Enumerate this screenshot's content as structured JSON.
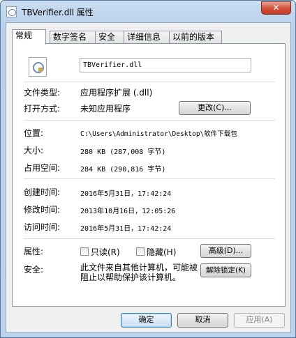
{
  "window": {
    "title": "TBVerifier.dll 属性",
    "close_label": "✕"
  },
  "tabs": [
    {
      "label": "常规"
    },
    {
      "label": "数字签名"
    },
    {
      "label": "安全"
    },
    {
      "label": "详细信息"
    },
    {
      "label": "以前的版本"
    }
  ],
  "general": {
    "filename": "TBVerifier.dll",
    "file_type_label": "文件类型:",
    "file_type_value": "应用程序扩展 (.dll)",
    "open_with_label": "打开方式:",
    "open_with_value": "未知应用程序",
    "change_button": "更改(C)...",
    "location_label": "位置:",
    "location_value": "C:\\Users\\Administrator\\Desktop\\软件下载包",
    "size_label": "大小:",
    "size_value": "280 KB (287,008 字节)",
    "size_on_disk_label": "占用空间:",
    "size_on_disk_value": "284 KB (290,816 字节)",
    "created_label": "创建时间:",
    "created_value": "2016年5月31日，17:42:24",
    "modified_label": "修改时间:",
    "modified_value": "2013年10月16日，12:05:26",
    "accessed_label": "访问时间:",
    "accessed_value": "2016年5月31日，17:42:24",
    "attributes_label": "属性:",
    "readonly_label": "只读(R)",
    "hidden_label": "隐藏(H)",
    "readonly_checked": false,
    "hidden_checked": false,
    "advanced_button": "高级(D)...",
    "security_label": "安全:",
    "security_text": "此文件来自其他计算机，可能被阻止以帮助保护该计算机。",
    "unblock_button": "解除锁定(K)"
  },
  "footer": {
    "ok_button": "确定",
    "cancel_button": "取消",
    "apply_button": "应用(A)"
  }
}
